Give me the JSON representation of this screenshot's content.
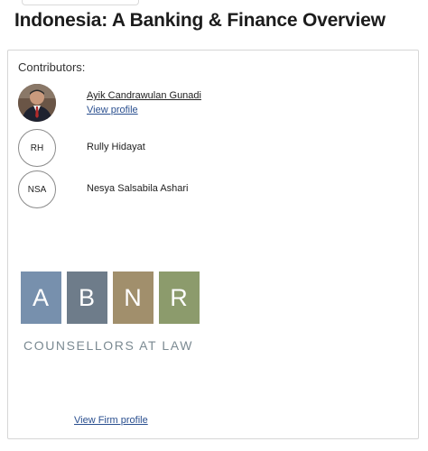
{
  "page": {
    "title": "Indonesia: A Banking & Finance Overview"
  },
  "contributors": {
    "heading": "Contributors:",
    "items": [
      {
        "name": "Ayik Candrawulan Gunadi",
        "link_label": "View profile",
        "avatar": "photo"
      },
      {
        "name": "Rully Hidayat",
        "initials": "RH"
      },
      {
        "name": "Nesya Salsabila Ashari",
        "initials": "NSA"
      }
    ]
  },
  "firm": {
    "logo_letters": [
      "A",
      "B",
      "N",
      "R"
    ],
    "logo_colors": [
      "#7790ad",
      "#6e7c8a",
      "#a18f6c",
      "#8c9b6c"
    ],
    "tagline": "COUNSELLORS AT LAW",
    "profile_link_label": "View Firm profile"
  }
}
